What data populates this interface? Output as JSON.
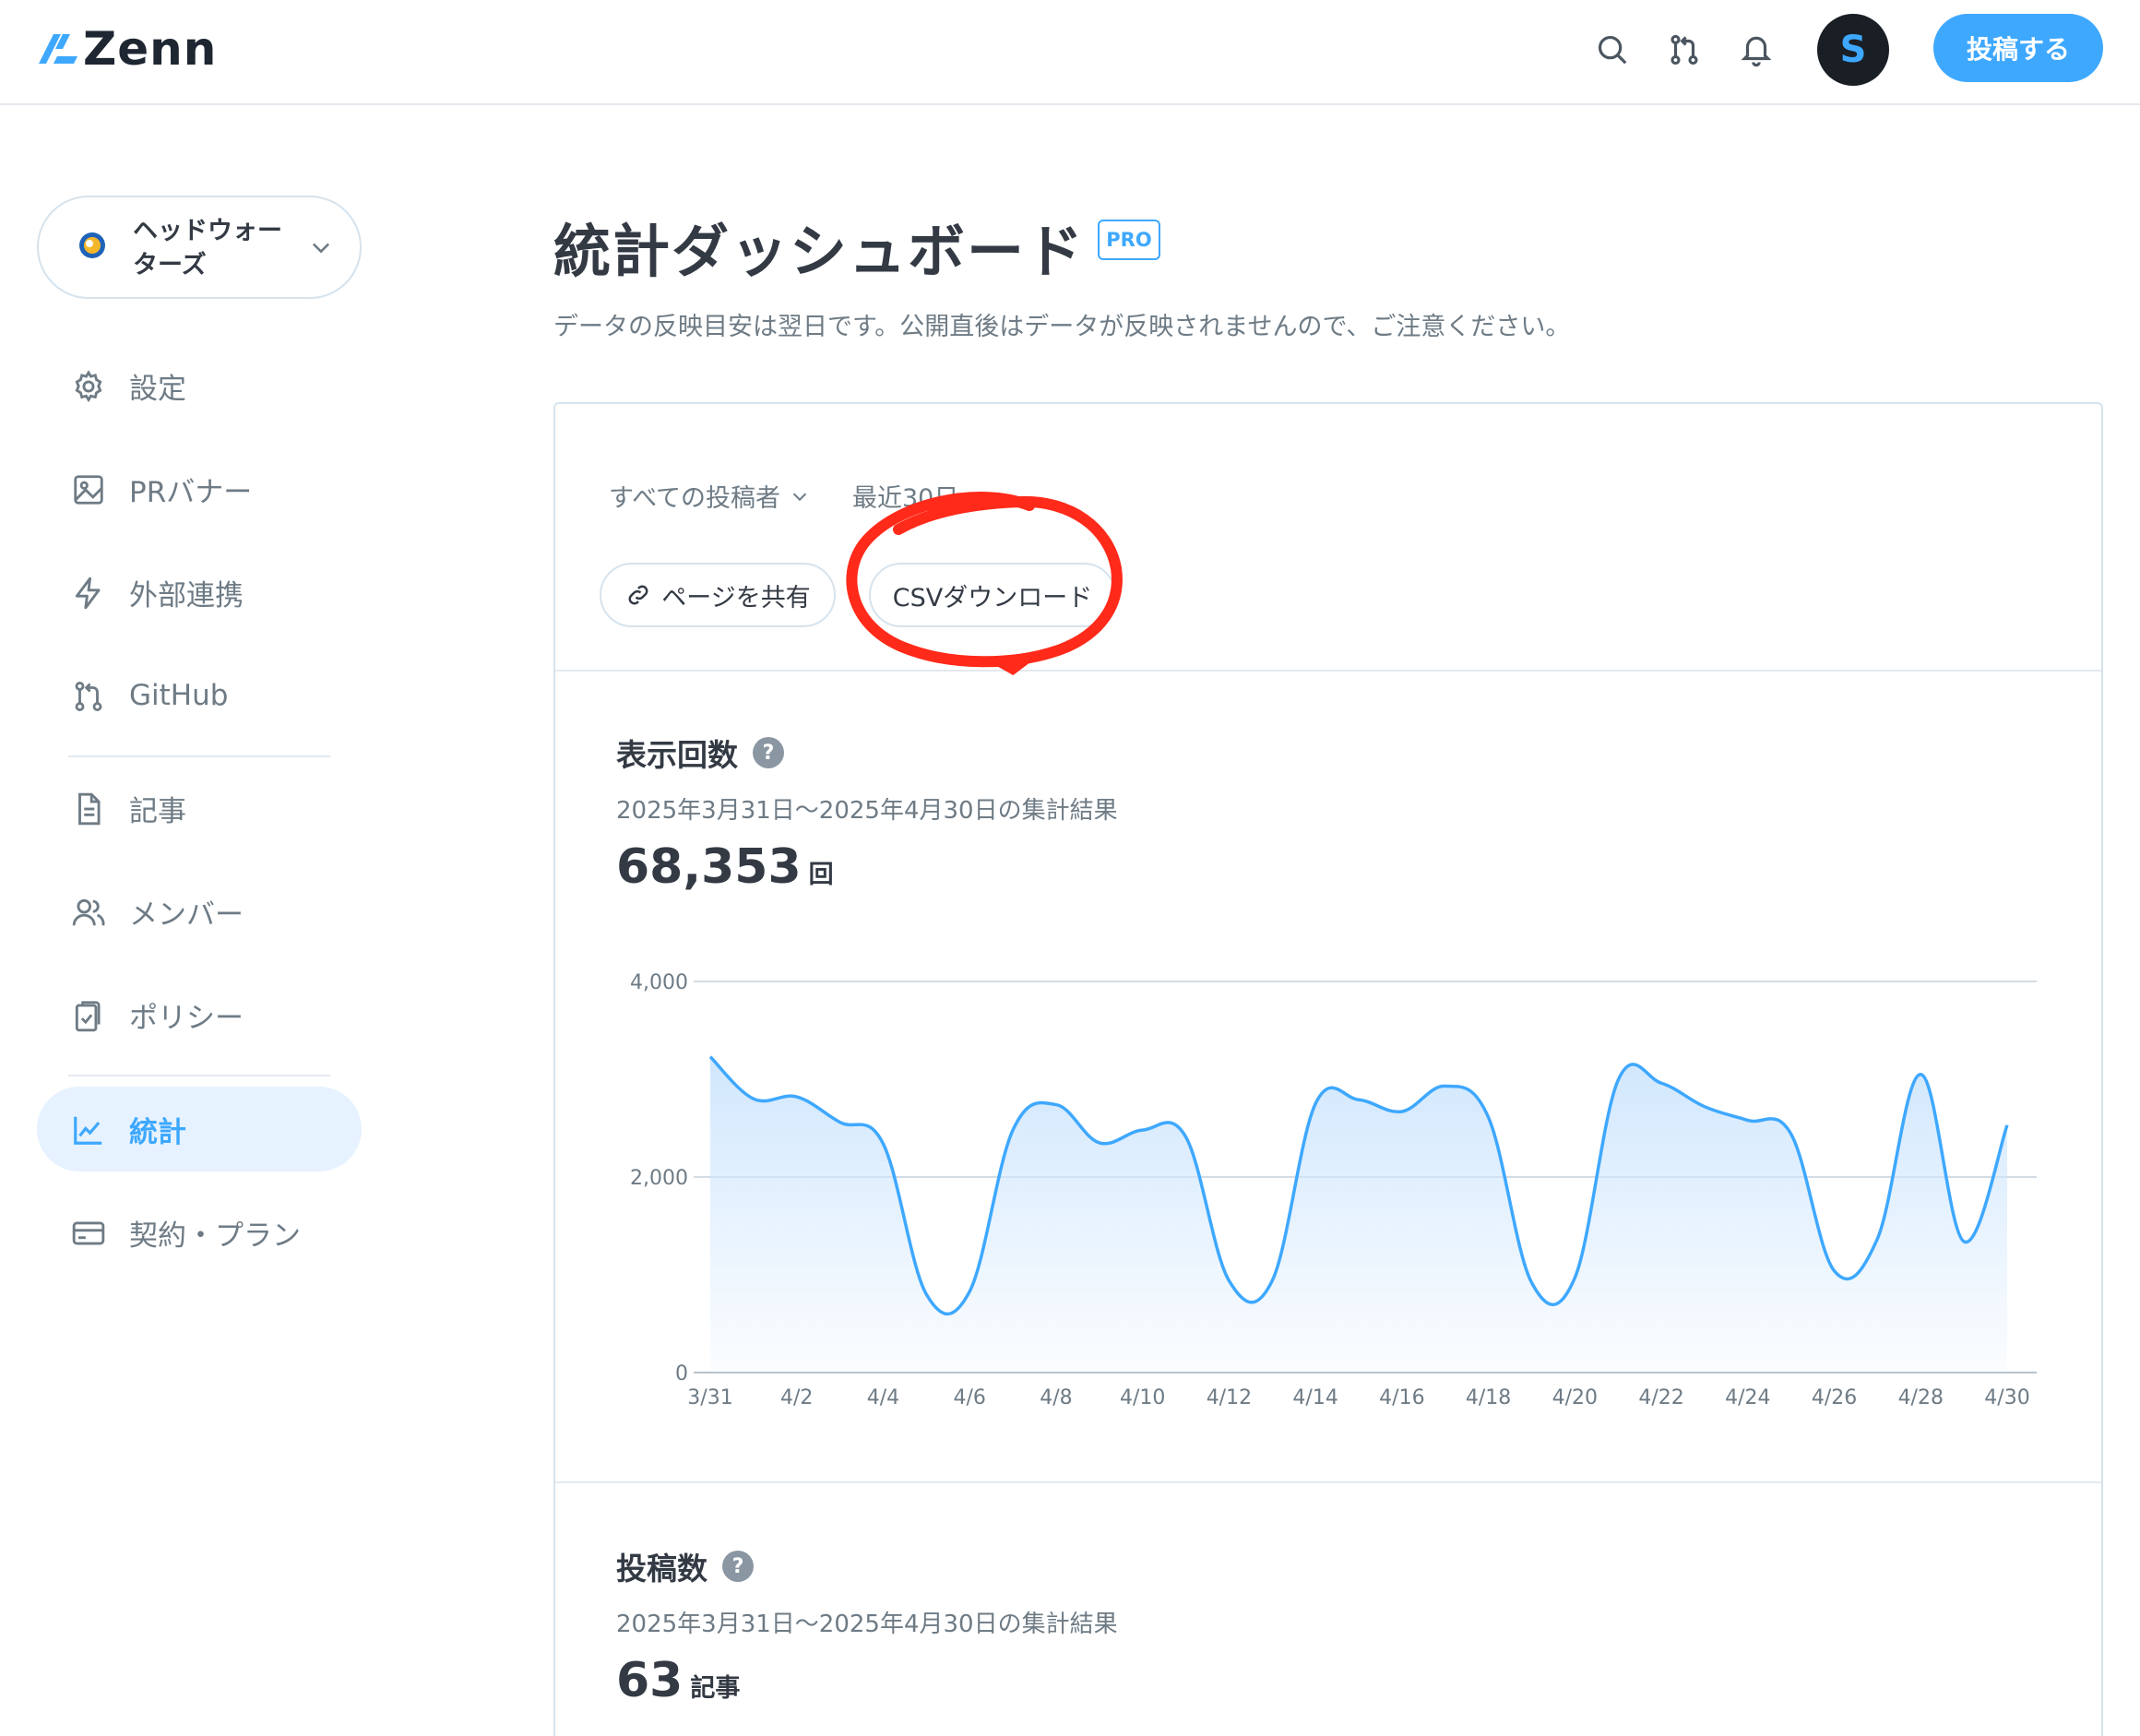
{
  "header": {
    "logo_text": "Zenn",
    "post_button": "投稿する",
    "avatar_initial": "S",
    "icons": [
      "search-icon",
      "pull-request-icon",
      "bell-icon"
    ]
  },
  "sidebar": {
    "org_name": "ヘッドウォーターズ",
    "items": [
      {
        "label": "設定",
        "icon": "gear-icon"
      },
      {
        "label": "PRバナー",
        "icon": "image-icon"
      },
      {
        "label": "外部連携",
        "icon": "lightning-icon"
      },
      {
        "label": "GitHub",
        "icon": "git-icon"
      },
      {
        "label": "記事",
        "icon": "document-icon"
      },
      {
        "label": "メンバー",
        "icon": "members-icon"
      },
      {
        "label": "ポリシー",
        "icon": "clipboard-check-icon"
      },
      {
        "label": "統計",
        "icon": "chart-icon",
        "active": true
      },
      {
        "label": "契約・プラン",
        "icon": "credit-card-icon"
      }
    ]
  },
  "main": {
    "title": "統計ダッシュボード",
    "badge": "PRO",
    "note": "データの反映目安は翌日です。公開直後はデータが反映されませんので、ご注意ください。",
    "filters": {
      "author": "すべての投稿者",
      "period": "最近30日"
    },
    "share_button": "ページを共有",
    "csv_button": "CSVダウンロード",
    "views": {
      "title": "表示回数",
      "range": "2025年3月31日〜2025年4月30日の集計結果",
      "total": "68,353",
      "unit": "回"
    },
    "posts": {
      "title": "投稿数",
      "range": "2025年3月31日〜2025年4月30日の集計結果",
      "total": "63",
      "unit": "記事"
    }
  },
  "chart_data": {
    "type": "area",
    "x": [
      "3/31",
      "4/1",
      "4/2",
      "4/3",
      "4/4",
      "4/5",
      "4/6",
      "4/7",
      "4/8",
      "4/9",
      "4/10",
      "4/11",
      "4/12",
      "4/13",
      "4/14",
      "4/15",
      "4/16",
      "4/17",
      "4/18",
      "4/19",
      "4/20",
      "4/21",
      "4/22",
      "4/23",
      "4/24",
      "4/25",
      "4/26",
      "4/27",
      "4/28",
      "4/29",
      "4/30"
    ],
    "x_tick_labels": [
      "3/31",
      "4/2",
      "4/4",
      "4/6",
      "4/8",
      "4/10",
      "4/12",
      "4/14",
      "4/16",
      "4/18",
      "4/20",
      "4/22",
      "4/24",
      "4/26",
      "4/28",
      "4/30"
    ],
    "values": [
      3230,
      2800,
      2820,
      2560,
      2340,
      800,
      830,
      2480,
      2740,
      2350,
      2480,
      2410,
      940,
      940,
      2750,
      2790,
      2670,
      2930,
      2610,
      920,
      970,
      2990,
      2960,
      2720,
      2580,
      2440,
      1040,
      1370,
      3050,
      1340,
      2530
    ],
    "ylim": [
      0,
      4000
    ],
    "y_ticks": [
      "0",
      "2,000",
      "4,000"
    ],
    "grid": true,
    "colors": {
      "line": "#3ea8ff",
      "fill": "#cfe6fd"
    }
  },
  "annotation": {
    "color": "#ff2a1a"
  }
}
